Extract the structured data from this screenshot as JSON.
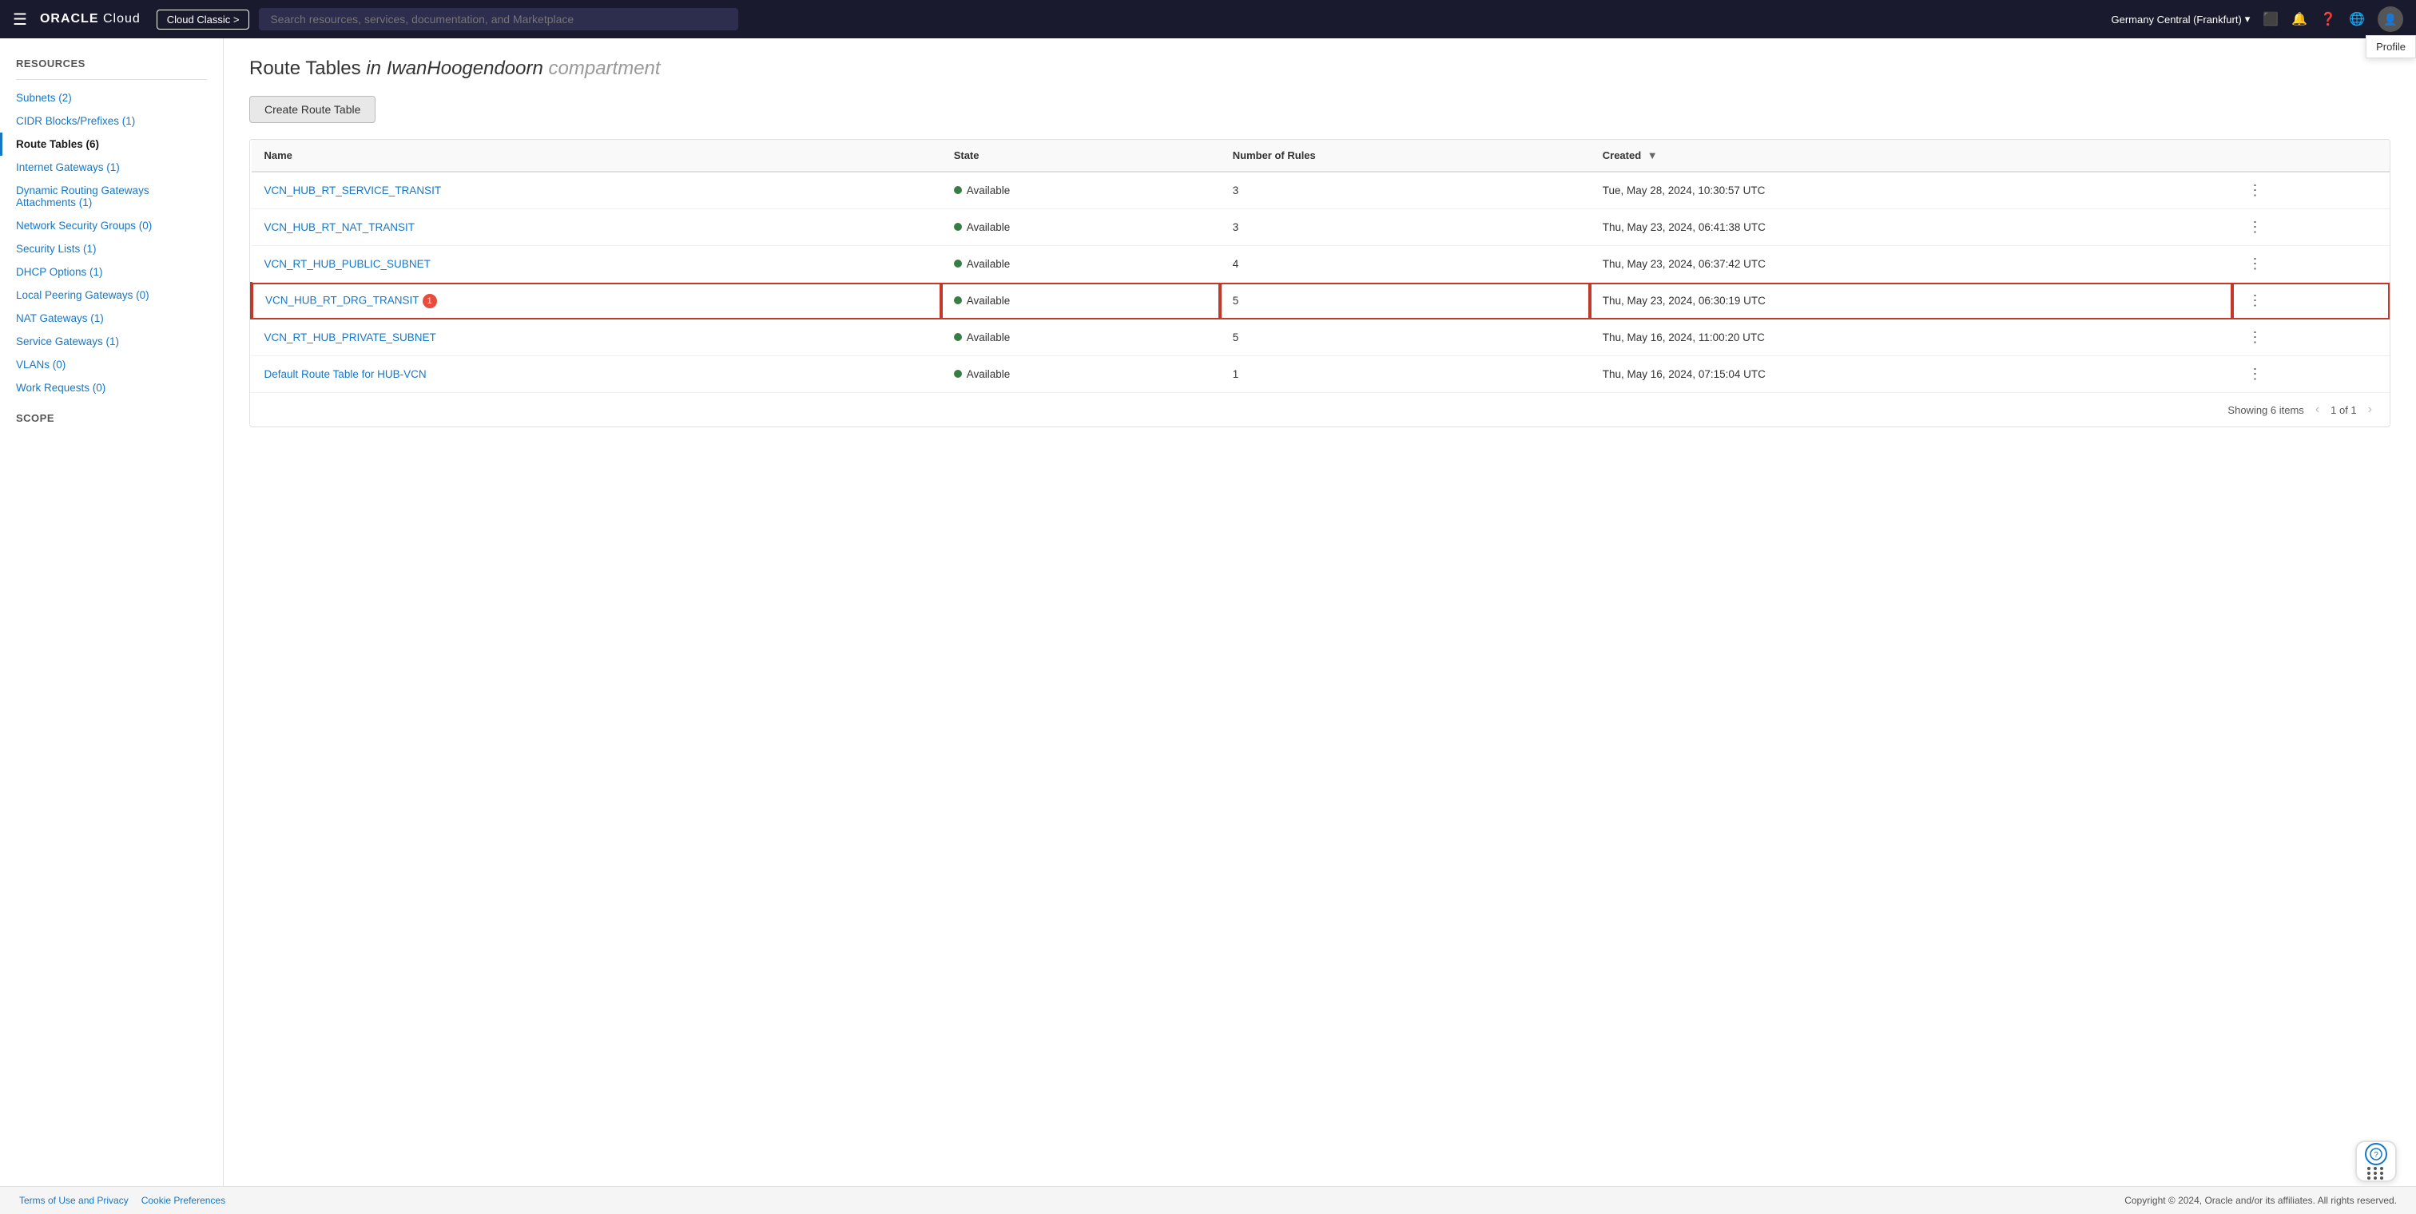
{
  "topnav": {
    "hamburger": "☰",
    "oracle_logo": "ORACLE",
    "cloud_label": "Cloud",
    "cloud_classic_btn": "Cloud Classic >",
    "search_placeholder": "Search resources, services, documentation, and Marketplace",
    "region": "Germany Central (Frankfurt)",
    "profile_tooltip": "Profile",
    "nav_icons": {
      "terminal": "⬜",
      "bell": "🔔",
      "help": "?",
      "globe": "🌐"
    }
  },
  "sidebar": {
    "resources_title": "Resources",
    "items": [
      {
        "label": "Subnets (2)",
        "active": false
      },
      {
        "label": "CIDR Blocks/Prefixes (1)",
        "active": false
      },
      {
        "label": "Route Tables (6)",
        "active": true
      },
      {
        "label": "Internet Gateways (1)",
        "active": false
      },
      {
        "label": "Dynamic Routing Gateways Attachments (1)",
        "active": false
      },
      {
        "label": "Network Security Groups (0)",
        "active": false
      },
      {
        "label": "Security Lists (1)",
        "active": false
      },
      {
        "label": "DHCP Options (1)",
        "active": false
      },
      {
        "label": "Local Peering Gateways (0)",
        "active": false
      },
      {
        "label": "NAT Gateways (1)",
        "active": false
      },
      {
        "label": "Service Gateways (1)",
        "active": false
      },
      {
        "label": "VLANs (0)",
        "active": false
      },
      {
        "label": "Work Requests (0)",
        "active": false
      }
    ],
    "scope_title": "Scope"
  },
  "main": {
    "page_title_prefix": "Route Tables",
    "page_title_in": "in",
    "page_title_compartment": "IwanHoogendoorn",
    "page_title_suffix": "compartment",
    "create_btn": "Create Route Table",
    "table": {
      "columns": [
        {
          "label": "Name",
          "sortable": false
        },
        {
          "label": "State",
          "sortable": false
        },
        {
          "label": "Number of Rules",
          "sortable": false
        },
        {
          "label": "Created",
          "sortable": true,
          "sort_arrow": "▼"
        }
      ],
      "rows": [
        {
          "name": "VCN_HUB_RT_SERVICE_TRANSIT",
          "state": "Available",
          "rules": "3",
          "created": "Tue, May 28, 2024, 10:30:57 UTC",
          "highlight": false,
          "badge": null
        },
        {
          "name": "VCN_HUB_RT_NAT_TRANSIT",
          "state": "Available",
          "rules": "3",
          "created": "Thu, May 23, 2024, 06:41:38 UTC",
          "highlight": false,
          "badge": null
        },
        {
          "name": "VCN_RT_HUB_PUBLIC_SUBNET",
          "state": "Available",
          "rules": "4",
          "created": "Thu, May 23, 2024, 06:37:42 UTC",
          "highlight": false,
          "badge": null
        },
        {
          "name": "VCN_HUB_RT_DRG_TRANSIT",
          "state": "Available",
          "rules": "5",
          "created": "Thu, May 23, 2024, 06:30:19 UTC",
          "highlight": true,
          "badge": "1"
        },
        {
          "name": "VCN_RT_HUB_PRIVATE_SUBNET",
          "state": "Available",
          "rules": "5",
          "created": "Thu, May 16, 2024, 11:00:20 UTC",
          "highlight": false,
          "badge": null
        },
        {
          "name": "Default Route Table for HUB-VCN",
          "state": "Available",
          "rules": "1",
          "created": "Thu, May 16, 2024, 07:15:04 UTC",
          "highlight": false,
          "badge": null
        }
      ],
      "footer_showing": "Showing 6 items",
      "footer_page": "1 of 1"
    }
  },
  "footer": {
    "terms_link": "Terms of Use and Privacy",
    "cookie_link": "Cookie Preferences",
    "copyright": "Copyright © 2024, Oracle and/or its affiliates. All rights reserved."
  }
}
